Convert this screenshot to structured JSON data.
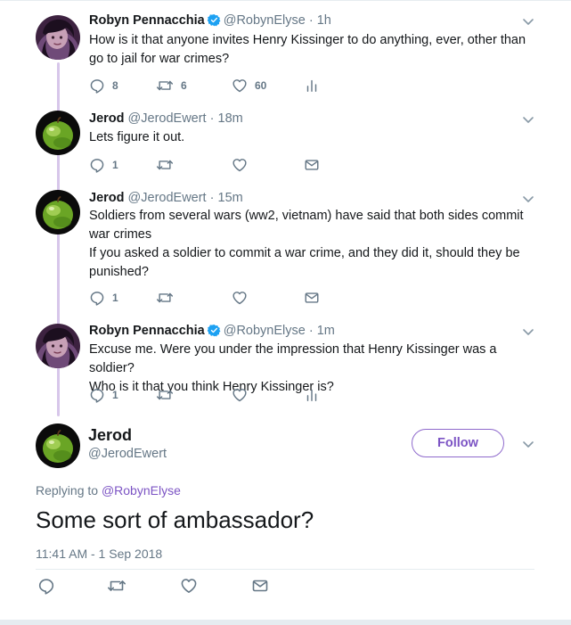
{
  "thread": [
    {
      "name": "Robyn Pennacchia",
      "verified": true,
      "handle": "@RobynElyse",
      "time": "1h",
      "text": "How is it that anyone invites Henry Kissinger to do anything, ever, other than go to jail for war crimes?",
      "actions": {
        "reply_count": "8",
        "retweet_count": "6",
        "like_count": "60",
        "last_icon": "analytics-icon"
      }
    },
    {
      "name": "Jerod",
      "verified": false,
      "handle": "@JerodEwert",
      "time": "18m",
      "text": "Lets figure it out.",
      "actions": {
        "reply_count": "1",
        "retweet_count": "",
        "like_count": "",
        "last_icon": "message-icon"
      }
    },
    {
      "name": "Jerod",
      "verified": false,
      "handle": "@JerodEwert",
      "time": "15m",
      "text_lines": [
        "Soldiers from several wars (ww2, vietnam) have said that both sides commit war crimes",
        "If you asked a soldier to commit a war crime, and they did it, should they be punished?"
      ],
      "actions": {
        "reply_count": "1",
        "retweet_count": "",
        "like_count": "",
        "last_icon": "message-icon"
      }
    },
    {
      "name": "Robyn Pennacchia",
      "verified": true,
      "handle": "@RobynElyse",
      "time": "1m",
      "text_lines": [
        "Excuse me. Were you under the impression that Henry Kissinger was a soldier?",
        "Who is it that you think Henry Kissinger is?"
      ],
      "actions": {
        "reply_count": "1",
        "retweet_count": "",
        "like_count": "",
        "last_icon": "analytics-icon"
      }
    }
  ],
  "main_tweet": {
    "name": "Jerod",
    "handle": "@JerodEwert",
    "follow_label": "Follow",
    "replying_prefix": "Replying to",
    "replying_handle": "@RobynElyse",
    "text": "Some sort of ambassador?",
    "timestamp": "11:41 AM - 1 Sep 2018",
    "actions": [
      "reply-icon",
      "retweet-icon",
      "like-icon",
      "message-icon"
    ]
  },
  "colors": {
    "accent": "#7c54c4",
    "thread_line": "#d7c6ea",
    "muted_text": "#657786",
    "verified_badge": "#1da1f2",
    "divider": "#e6ecf0"
  }
}
